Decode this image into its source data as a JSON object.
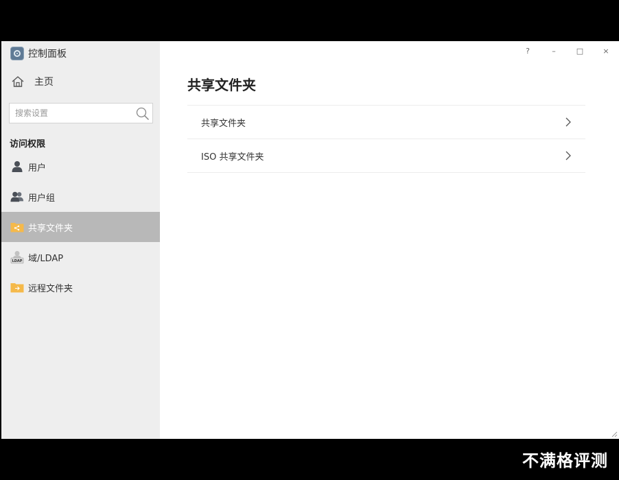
{
  "app": {
    "title": "控制面板",
    "icon": "control-panel-icon"
  },
  "sidebar": {
    "home_label": "主页",
    "search_placeholder": "搜索设置",
    "section_title": "访问权限",
    "items": [
      {
        "label": "用户",
        "icon": "user-icon"
      },
      {
        "label": "用户组",
        "icon": "user-group-icon"
      },
      {
        "label": "共享文件夹",
        "icon": "shared-folder-icon",
        "active": true
      },
      {
        "label": "域/LDAP",
        "icon": "ldap-icon"
      },
      {
        "label": "远程文件夹",
        "icon": "remote-folder-icon"
      }
    ]
  },
  "window_controls": {
    "help": "?",
    "minimize": "–",
    "maximize": "□",
    "close": "×"
  },
  "main": {
    "title": "共享文件夹",
    "rows": [
      {
        "label": "共享文件夹"
      },
      {
        "label": "ISO 共享文件夹"
      }
    ]
  },
  "watermark": "不满格评测",
  "colors": {
    "active_item_bg": "#b8b8b8",
    "sidebar_bg": "#eeeeee",
    "folder_yellow": "#f5b94a"
  }
}
